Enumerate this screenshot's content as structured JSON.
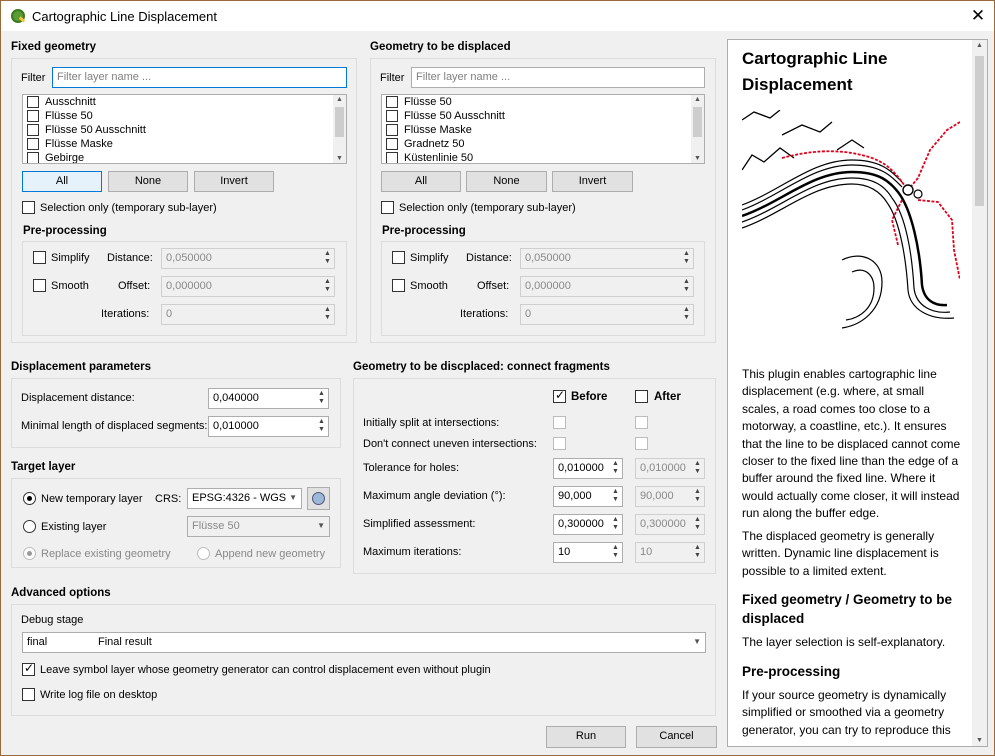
{
  "window": {
    "title": "Cartographic Line Displacement",
    "close": "✕"
  },
  "fixed": {
    "heading": "Fixed geometry",
    "filter_label": "Filter",
    "filter_placeholder": "Filter layer name ...",
    "layers": [
      "Ausschnitt",
      "Flüsse 50",
      "Flüsse 50 Ausschnitt",
      "Flüsse Maske",
      "Gebirge"
    ],
    "btn_all": "All",
    "btn_none": "None",
    "btn_invert": "Invert",
    "selection_only": "Selection only (temporary sub-layer)",
    "pre": {
      "heading": "Pre-processing",
      "simplify": "Simplify",
      "smooth": "Smooth",
      "distance_label": "Distance:",
      "distance": "0,050000",
      "offset_label": "Offset:",
      "offset": "0,000000",
      "iterations_label": "Iterations:",
      "iterations": "0"
    }
  },
  "displaced": {
    "heading": "Geometry to be displaced",
    "filter_label": "Filter",
    "filter_placeholder": "Filter layer name ...",
    "layers": [
      "Flüsse 50",
      "Flüsse 50 Ausschnitt",
      "Flüsse Maske",
      "Gradnetz 50",
      "Küstenlinie 50"
    ],
    "btn_all": "All",
    "btn_none": "None",
    "btn_invert": "Invert",
    "selection_only": "Selection only (temporary sub-layer)",
    "pre": {
      "heading": "Pre-processing",
      "simplify": "Simplify",
      "smooth": "Smooth",
      "distance_label": "Distance:",
      "distance": "0,050000",
      "offset_label": "Offset:",
      "offset": "0,000000",
      "iterations_label": "Iterations:",
      "iterations": "0"
    }
  },
  "params": {
    "heading": "Displacement parameters",
    "distance_label": "Displacement distance:",
    "distance": "0,040000",
    "minlen_label": "Minimal length of displaced segments:",
    "minlen": "0,010000"
  },
  "target": {
    "heading": "Target layer",
    "new_temp": "New temporary layer",
    "crs_label": "CRS:",
    "crs": "EPSG:4326 - WGS",
    "existing": "Existing layer",
    "existing_layer": "Flüsse 50",
    "replace": "Replace existing geometry",
    "append": "Append new geometry"
  },
  "connect": {
    "heading": "Geometry to be discplaced: connect fragments",
    "before": "Before",
    "after": "After",
    "split": "Initially split at intersections:",
    "uneven": "Don't connect uneven intersections:",
    "tol_label": "Tolerance for holes:",
    "tol_before": "0,010000",
    "tol_after": "0,010000",
    "angle_label": "Maximum angle deviation (°):",
    "angle_before": "90,000",
    "angle_after": "90,000",
    "simp_label": "Simplified assessment:",
    "simp_before": "0,300000",
    "simp_after": "0,300000",
    "iter_label": "Maximum iterations:",
    "iter_before": "10",
    "iter_after": "10"
  },
  "advanced": {
    "heading": "Advanced options",
    "debug_label": "Debug stage",
    "debug_code": "final",
    "debug_value": "Final result",
    "leave_symbol": "Leave symbol layer whose geometry generator can control displacement even without plugin",
    "write_log": "Write log file on desktop"
  },
  "actions": {
    "run": "Run",
    "cancel": "Cancel"
  },
  "help": {
    "title": "Cartographic Line Displacement",
    "p1": "This plugin enables cartographic line displacement (e.g. where, at small scales, a road comes too close to a motorway, a coastline, etc.). It ensures that the line to be displaced cannot come closer to the fixed line than the edge of a buffer around the fixed line. Where it would actually come closer, it will instead run along the buffer edge.",
    "p2": "The displaced geometry is generally written. Dynamic line displacement is possible to a limited extent.",
    "h2": "Fixed geometry / Geometry to be displaced",
    "p3": "The layer selection is self-explanatory.",
    "h3": "Pre-processing",
    "p4": "If your source geometry is dynamically simplified or smoothed via a geometry generator, you can try to reproduce this"
  },
  "colors": {
    "accent": "#0078d7",
    "red_line": "#e0001b",
    "border": "#9a6a3a"
  }
}
